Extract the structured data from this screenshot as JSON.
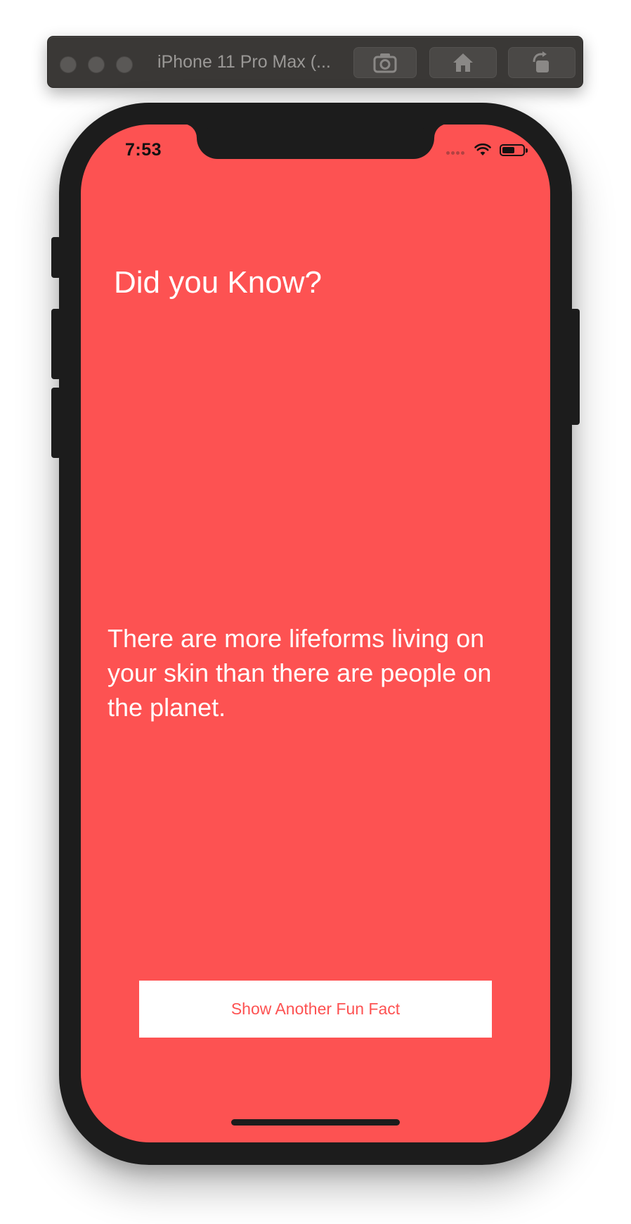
{
  "simulator": {
    "title": "iPhone 11 Pro Max (...",
    "buttons": {
      "screenshot_icon": "camera-icon",
      "home_icon": "home-icon",
      "rotate_icon": "rotate-icon"
    }
  },
  "status_bar": {
    "time": "7:53",
    "wifi_icon": "wifi-icon",
    "battery_icon": "battery-icon",
    "battery_level": 0.6
  },
  "app": {
    "headline": "Did you Know?",
    "fact": "There are more lifeforms living on your skin than there are people on the planet.",
    "button_label": "Show Another Fun Fact",
    "background_color": "#fd5252",
    "button_text_color": "#fd5252"
  }
}
